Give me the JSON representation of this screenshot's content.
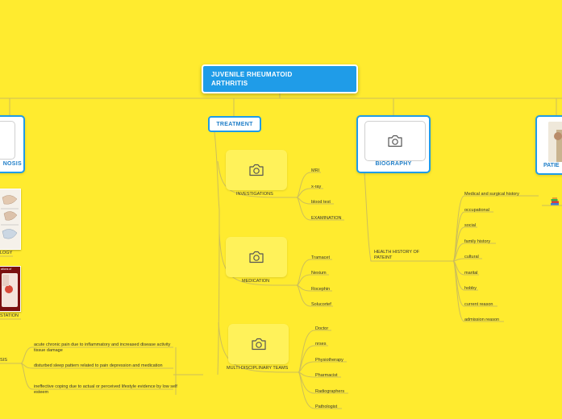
{
  "root": {
    "title": "JUVENILE RHEUMATOID ARTHRITIS"
  },
  "left_partial": {
    "diagnosis_title": "NOSIS",
    "pathology_label": "LOGY",
    "manifestation_label": "STATION",
    "manifestation_image_text": "ations of",
    "nursing_diagnosis_label": "SIS",
    "diagnoses": [
      "acute chronic pain due to inflammatory and increased disease activity tissue damage",
      "disturbed sleep pattern related to pain depression and medication",
      "ineffective coping due to actual or perceived lifestyle evidence by low self esteem"
    ]
  },
  "treatment": {
    "title": "TREATMENT",
    "investigations": {
      "label": "INVESTIGATIONS",
      "items": [
        "MRI",
        "x-ray",
        "blood test",
        "EXAMINATION"
      ]
    },
    "medication": {
      "label": "MEDICATION",
      "items": [
        "Tramacet",
        "Nexium",
        "Rocephin",
        "Solucortef"
      ]
    },
    "team": {
      "label": "MULTI-DISCIPLINARY TEAMS",
      "items": [
        "Doctor",
        "nrses",
        "Physiotherapy",
        "Pharmacist",
        "Radiographers",
        "Pathologist"
      ]
    }
  },
  "biography": {
    "title": "BIOGRAPHY",
    "history": {
      "label": "HEALTH HISTORY OF PATEINT",
      "items": [
        "Medical and surgical history",
        "occupational",
        "social",
        "family history",
        "cultural",
        "marital",
        "hobby",
        "current reason",
        "admission reason"
      ]
    }
  },
  "patient": {
    "title": "PATIE"
  },
  "colors": {
    "background": "#FFEB2F",
    "accent": "#1F9CE8",
    "line": "#C8B23A"
  },
  "icons": [
    "camera-icon",
    "books-icon"
  ]
}
